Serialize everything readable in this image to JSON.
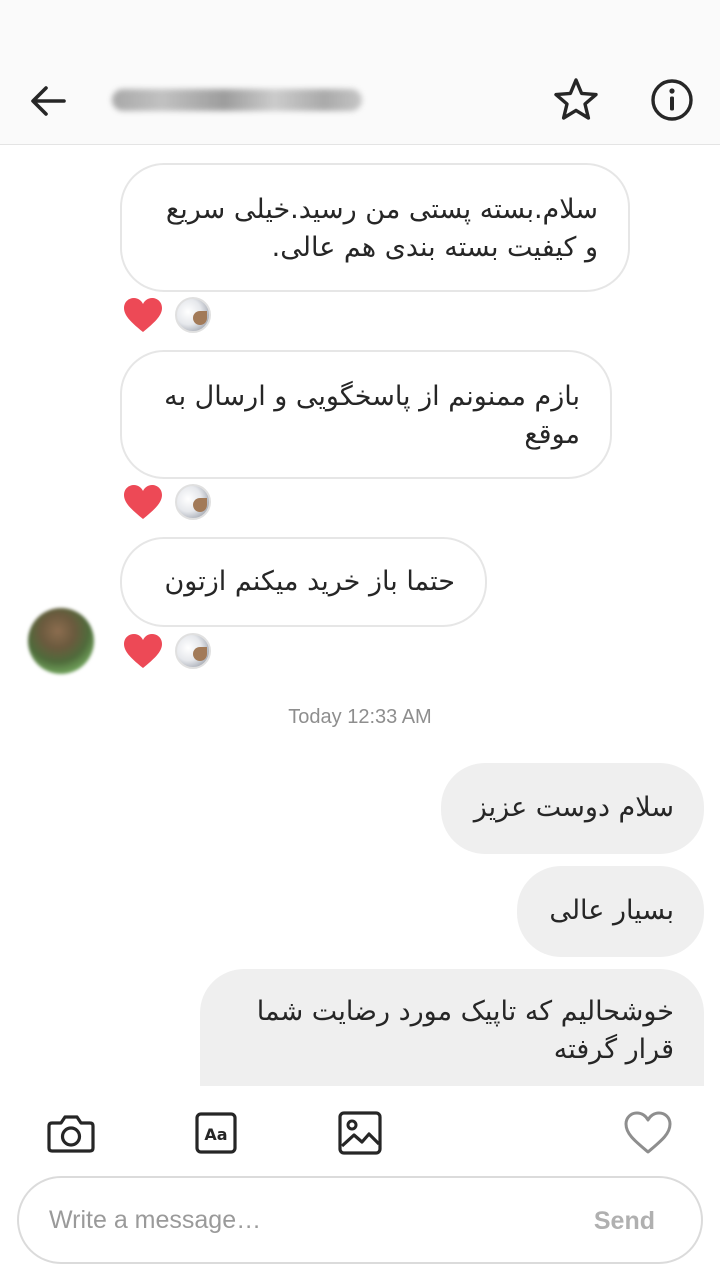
{
  "header": {
    "back_icon": "arrow-left-icon",
    "star_icon": "star-icon",
    "info_icon": "info-icon"
  },
  "conversation": {
    "incoming": [
      {
        "text": "سلام.بسته پستی من رسید.خیلی سریع و کیفیت بسته بندی هم عالی.",
        "reaction": "heart"
      },
      {
        "text": "بازم ممنونم از پاسخگویی و ارسال به موقع",
        "reaction": "heart"
      },
      {
        "text": "حتما باز خرید میکنم ازتون",
        "reaction": "heart"
      }
    ],
    "timestamp": "Today 12:33 AM",
    "outgoing": [
      {
        "text": "سلام دوست عزیز"
      },
      {
        "text": "بسیار عالی"
      },
      {
        "text": "خوشحالیم که تاپیک مورد رضایت شما قرار گرفته"
      }
    ]
  },
  "toolbar": {
    "icons": [
      "camera-icon",
      "text-style-icon",
      "gallery-icon",
      "heart-icon"
    ]
  },
  "composer": {
    "placeholder": "Write a message…",
    "send_label": "Send"
  },
  "colors": {
    "heart_red": "#ed4956",
    "outgoing_bubble": "#efefef",
    "incoming_border": "#e6e6e6",
    "timestamp": "#8e8e8e",
    "send_disabled": "#b0b0b0"
  }
}
